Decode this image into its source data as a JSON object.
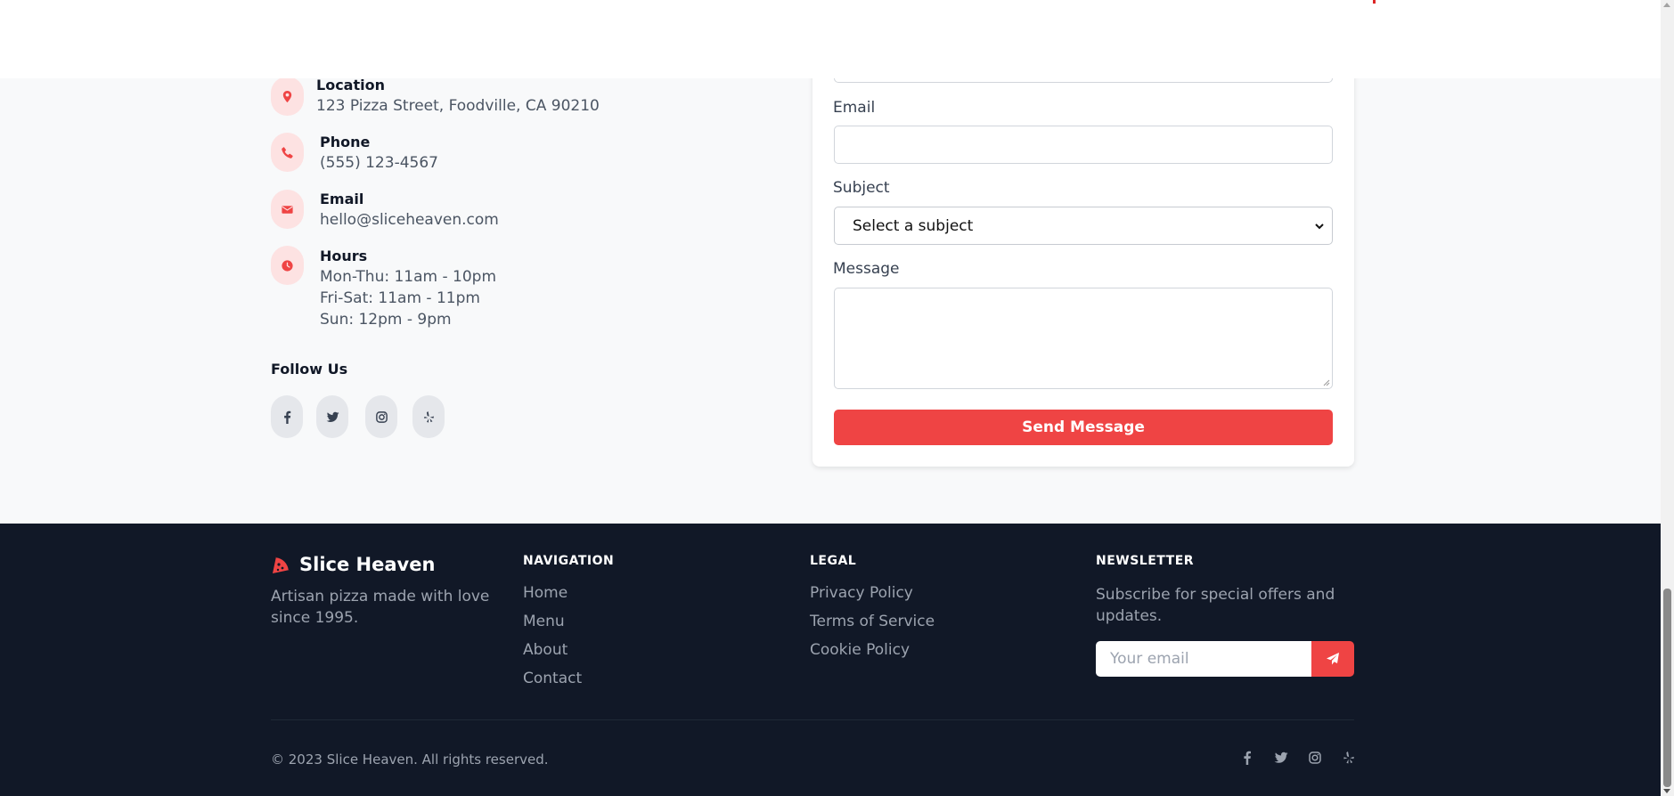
{
  "contact_info": [
    {
      "title": "Location",
      "lines": [
        "123 Pizza Street, Foodville, CA 90210"
      ],
      "icon": "map-pin-icon"
    },
    {
      "title": "Phone",
      "lines": [
        "(555) 123-4567"
      ],
      "icon": "phone-icon"
    },
    {
      "title": "Email",
      "lines": [
        "hello@sliceheaven.com"
      ],
      "icon": "envelope-icon"
    },
    {
      "title": "Hours",
      "lines": [
        "Mon-Thu: 11am - 10pm",
        "Fri-Sat: 11am - 11pm",
        "Sun: 12pm - 9pm"
      ],
      "icon": "clock-icon"
    }
  ],
  "follow": {
    "title": "Follow Us",
    "networks": [
      "facebook-icon",
      "twitter-icon",
      "instagram-icon",
      "yelp-icon"
    ]
  },
  "form": {
    "email_label": "Email",
    "subject_label": "Subject",
    "subject_selected": "Select a subject",
    "message_label": "Message",
    "submit_label": "Send Message"
  },
  "footer": {
    "brand_name": "Slice Heaven",
    "brand_desc": "Artisan pizza made with love since 1995.",
    "navigation": {
      "title": "NAVIGATION",
      "links": [
        "Home",
        "Menu",
        "About",
        "Contact"
      ]
    },
    "legal": {
      "title": "LEGAL",
      "links": [
        "Privacy Policy",
        "Terms of Service",
        "Cookie Policy"
      ]
    },
    "newsletter": {
      "title": "NEWSLETTER",
      "desc": "Subscribe for special offers and updates.",
      "placeholder": "Your email"
    },
    "copyright": "© 2023 Slice Heaven. All rights reserved."
  },
  "colors": {
    "accent": "#ef4444",
    "footer_bg": "#111827",
    "icon_bg": "#fde2e2"
  }
}
